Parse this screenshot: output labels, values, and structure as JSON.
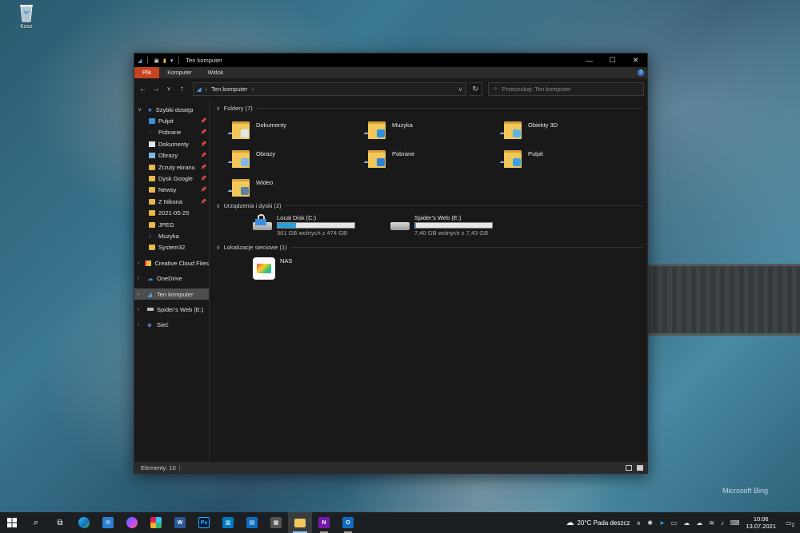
{
  "desktop": {
    "recycle_bin_label": "Kosz",
    "watermark": "Microsoft Bing"
  },
  "window": {
    "title": "Ten komputer",
    "ribbon_tabs": [
      "Plik",
      "Komputer",
      "Widok"
    ],
    "address": {
      "crumbs": [
        "Ten komputer"
      ]
    },
    "search_placeholder": "Przeszukaj: Ten komputer",
    "nav": {
      "quick_access": "Szybki dostęp",
      "pinned": [
        {
          "label": "Pulpit"
        },
        {
          "label": "Pobrane"
        },
        {
          "label": "Dokumenty"
        },
        {
          "label": "Obrazy"
        },
        {
          "label": "Zrzuty ekranu"
        },
        {
          "label": "Dysk Google"
        },
        {
          "label": "Newsy"
        },
        {
          "label": "Z Nikona"
        },
        {
          "label": "2021-05-25"
        },
        {
          "label": "JPEG"
        },
        {
          "label": "Muzyka"
        },
        {
          "label": "System32"
        }
      ],
      "roots": [
        {
          "label": "Creative Cloud Files"
        },
        {
          "label": "OneDrive"
        },
        {
          "label": "Ten komputer"
        },
        {
          "label": "Spider's Web (E:)"
        },
        {
          "label": "Sieć"
        }
      ]
    },
    "groups": {
      "folders_header": "Foldery (7)",
      "folders": [
        {
          "name": "Dokumenty",
          "badge_color": "#dfe7ef"
        },
        {
          "name": "Muzyka",
          "badge_color": "#2c8fe0"
        },
        {
          "name": "Obiekty 3D",
          "badge_color": "#5fb3e8"
        },
        {
          "name": "Obrazy",
          "badge_color": "#7fb8e6"
        },
        {
          "name": "Pobrane",
          "badge_color": "#2b7fd6"
        },
        {
          "name": "Pulpit",
          "badge_color": "#3aa0e6"
        },
        {
          "name": "Wideo",
          "badge_color": "#5b7fa8"
        }
      ],
      "drives_header": "Urządzenia i dyski (2)",
      "drives": [
        {
          "name": "Local Disk (C:)",
          "free": "361 GB wolnych z 474 GB",
          "used_fraction": 0.24
        },
        {
          "name": "Spider's Web (E:)",
          "free": "7,40 GB wolnych z 7,43 GB",
          "used_fraction": 0.01
        }
      ],
      "network_header": "Lokalizacje sieciowe (1)",
      "network": [
        {
          "name": "NAS"
        }
      ]
    },
    "status": "Elementy: 10"
  },
  "taskbar": {
    "weather": "20°C  Pada deszcz",
    "time": "10:06",
    "date": "13.07.2021",
    "notifications": "2"
  }
}
